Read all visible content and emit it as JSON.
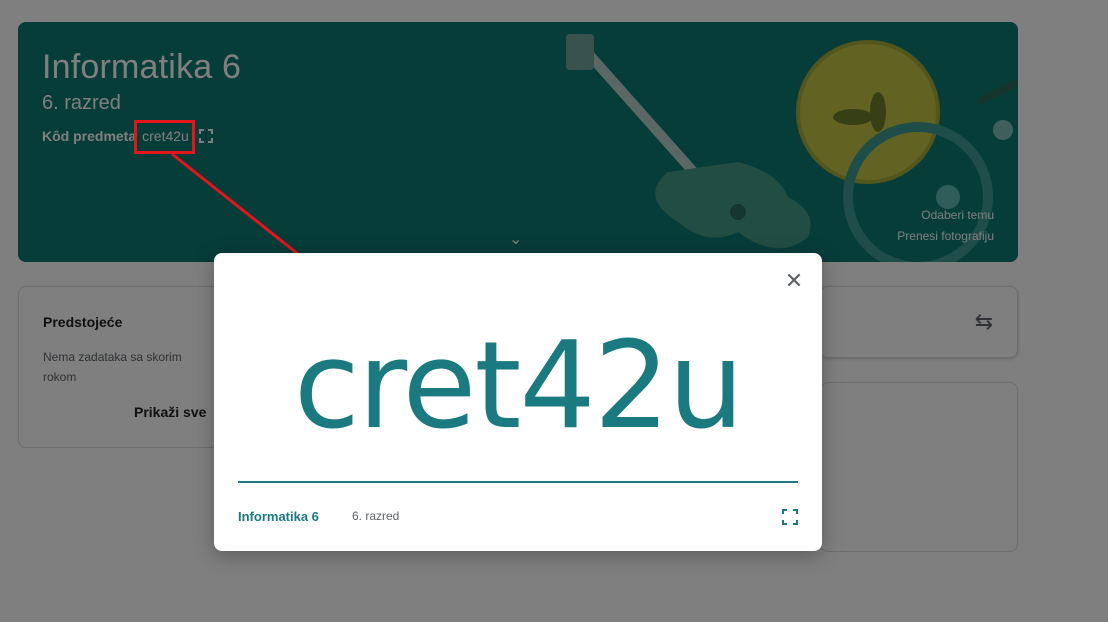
{
  "banner": {
    "class_name": "Informatika 6",
    "section": "6. razred",
    "code_label": "Kôd predmeta",
    "code_value": "cret42u",
    "select_theme": "Odaberi temu",
    "upload_photo": "Prenesi fotografiju"
  },
  "upcoming": {
    "title": "Predstojeće",
    "empty_text": "Nema zadataka sa skorim rokom",
    "show_all": "Prikaži sve"
  },
  "dialog": {
    "code": "cret42u",
    "class_name": "Informatika 6",
    "section": "6. razred"
  },
  "icons": {
    "close": "close-icon",
    "fullscreen": "fullscreen-icon",
    "chevron": "chevron-down-icon",
    "swap": "swap-icon"
  },
  "colors": {
    "banner_bg": "#0e7b72",
    "accent": "#1a7a7f",
    "annotation": "#e4151b"
  }
}
